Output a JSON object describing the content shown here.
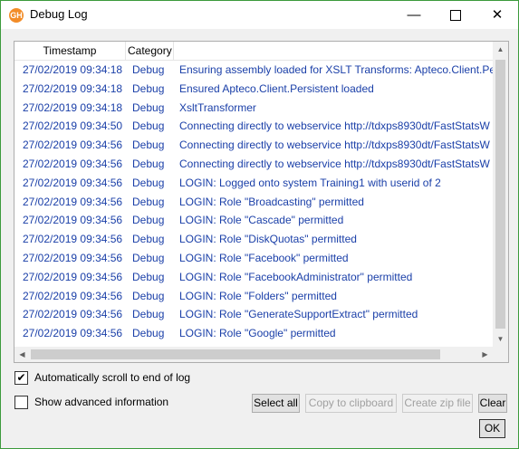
{
  "window": {
    "title": "Debug Log",
    "app_icon_text": "GH",
    "minimize_glyph": "—",
    "close_glyph": "✕"
  },
  "log": {
    "columns": {
      "timestamp": "Timestamp",
      "category": "Category"
    },
    "rows": [
      {
        "timestamp": "27/02/2019 09:34:18",
        "category": "Debug",
        "message": "Ensuring assembly loaded for XSLT Transforms: Apteco.Client.Peo"
      },
      {
        "timestamp": "27/02/2019 09:34:18",
        "category": "Debug",
        "message": "Ensured Apteco.Client.Persistent loaded"
      },
      {
        "timestamp": "27/02/2019 09:34:18",
        "category": "Debug",
        "message": "XsltTransformer"
      },
      {
        "timestamp": "27/02/2019 09:34:50",
        "category": "Debug",
        "message": "Connecting directly to webservice http://tdxps8930dt/FastStatsW"
      },
      {
        "timestamp": "27/02/2019 09:34:56",
        "category": "Debug",
        "message": "Connecting directly to webservice http://tdxps8930dt/FastStatsW"
      },
      {
        "timestamp": "27/02/2019 09:34:56",
        "category": "Debug",
        "message": "Connecting directly to webservice http://tdxps8930dt/FastStatsW"
      },
      {
        "timestamp": "27/02/2019 09:34:56",
        "category": "Debug",
        "message": "LOGIN: Logged onto system Training1 with userid of 2"
      },
      {
        "timestamp": "27/02/2019 09:34:56",
        "category": "Debug",
        "message": "LOGIN: Role \"Broadcasting\" permitted"
      },
      {
        "timestamp": "27/02/2019 09:34:56",
        "category": "Debug",
        "message": "LOGIN: Role \"Cascade\" permitted"
      },
      {
        "timestamp": "27/02/2019 09:34:56",
        "category": "Debug",
        "message": "LOGIN: Role \"DiskQuotas\" permitted"
      },
      {
        "timestamp": "27/02/2019 09:34:56",
        "category": "Debug",
        "message": "LOGIN: Role \"Facebook\" permitted"
      },
      {
        "timestamp": "27/02/2019 09:34:56",
        "category": "Debug",
        "message": "LOGIN: Role \"FacebookAdministrator\" permitted"
      },
      {
        "timestamp": "27/02/2019 09:34:56",
        "category": "Debug",
        "message": "LOGIN: Role \"Folders\" permitted"
      },
      {
        "timestamp": "27/02/2019 09:34:56",
        "category": "Debug",
        "message": "LOGIN: Role \"GenerateSupportExtract\" permitted"
      },
      {
        "timestamp": "27/02/2019 09:34:56",
        "category": "Debug",
        "message": "LOGIN: Role \"Google\" permitted"
      }
    ]
  },
  "options": {
    "auto_scroll": {
      "label": "Automatically scroll to end of log",
      "checked": true
    },
    "advanced": {
      "label": "Show advanced information",
      "checked": false
    }
  },
  "buttons": {
    "select_all": "Select all",
    "copy": "Copy to clipboard",
    "zip": "Create zip file",
    "clear": "Clear",
    "ok": "OK"
  },
  "colors": {
    "row_text": "#1a3fa8",
    "window_border": "#3c9a3c",
    "icon": "#f28c28"
  }
}
